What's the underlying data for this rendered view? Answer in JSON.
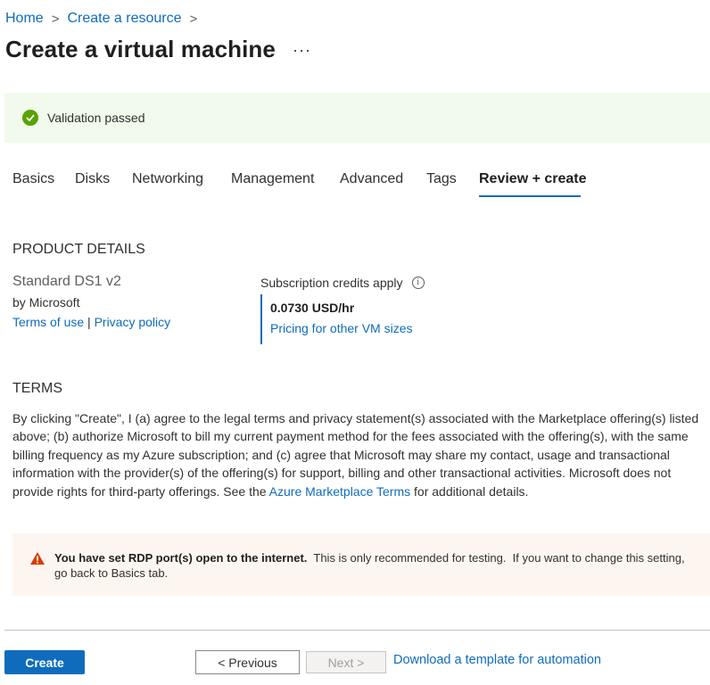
{
  "breadcrumb": {
    "items": [
      "Home",
      "Create a resource"
    ],
    "separator": ">"
  },
  "title": "Create a virtual machine",
  "more_label": "···",
  "validation": {
    "text": "Validation passed",
    "status_color": "#57a300"
  },
  "tabs": [
    {
      "label": "Basics"
    },
    {
      "label": "Disks"
    },
    {
      "label": "Networking"
    },
    {
      "label": "Management"
    },
    {
      "label": "Advanced"
    },
    {
      "label": "Tags"
    },
    {
      "label": "Review + create",
      "active": true
    }
  ],
  "product": {
    "heading": "PRODUCT DETAILS",
    "name": "Standard DS1 v2",
    "publisher": "by Microsoft",
    "terms_link": "Terms of use",
    "link_separator": "|",
    "privacy_link": "Privacy policy",
    "credits_label": "Subscription credits apply",
    "info_icon": "info-icon",
    "price": "0.0730 USD/hr",
    "pricing_link": "Pricing for other VM sizes"
  },
  "terms": {
    "heading": "TERMS",
    "lines": [
      "By clicking \"Create\", I (a) agree to the legal terms and privacy statement(s) associated with the Marketplace offering(s) listed",
      "above; (b) authorize Microsoft to bill my current payment method for the fees associated with the offering(s), with the same",
      "billing frequency as my Azure subscription; and (c) agree that Microsoft may share my contact, usage and transactional",
      "information with the provider(s) of the offering(s) for support, billing and other transactional activities. Microsoft does not"
    ],
    "last_line_before": "provide rights for third-party offerings. See the ",
    "marketplace_link": "Azure Marketplace Terms",
    "last_line_after": " for additional details."
  },
  "warning": {
    "bold": "You have set RDP port(s) open to the internet.",
    "text1": "  This is only recommended for testing.  If you want to change this setting,",
    "text2": "go back to Basics tab.",
    "icon": "warning-icon",
    "color": "#d83b01"
  },
  "footer": {
    "create_label": "Create",
    "previous_label": "< Previous",
    "next_label": "Next >",
    "template_link": "Download a template for automation"
  },
  "colors": {
    "accent": "#0f6cbd",
    "success_bg": "#f1faec",
    "warning_bg": "#fdf6f0"
  }
}
